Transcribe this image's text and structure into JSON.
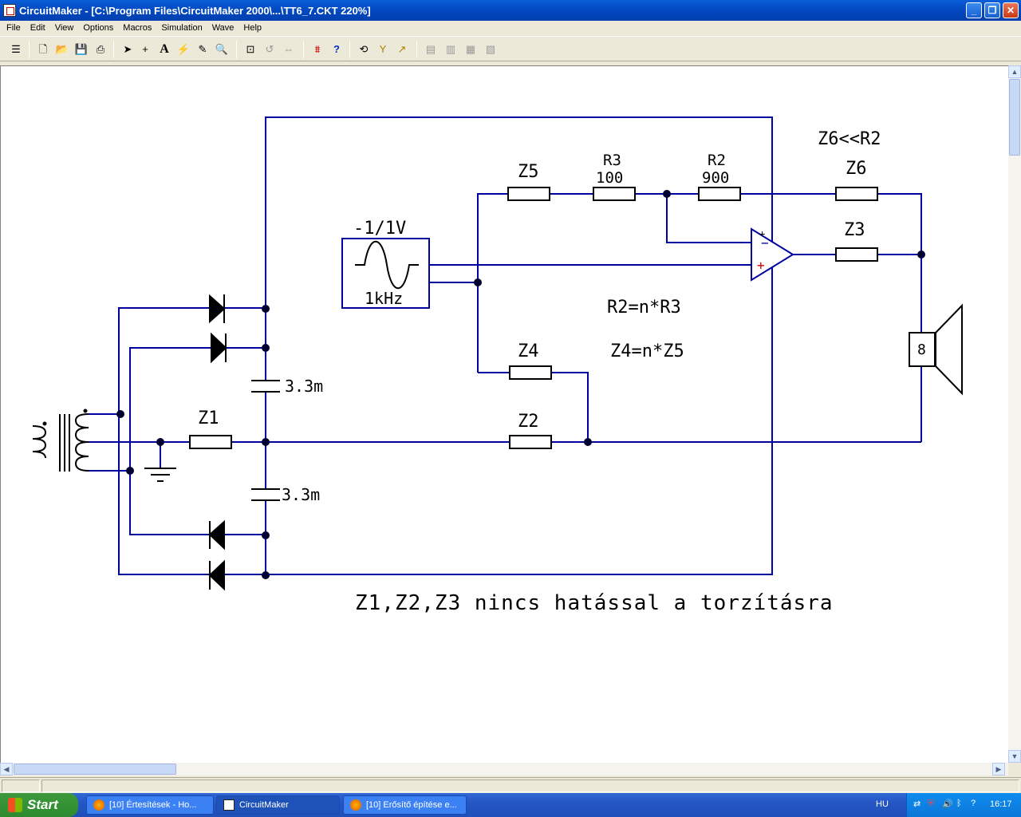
{
  "window": {
    "title": "CircuitMaker - [C:\\Program Files\\CircuitMaker 2000\\...\\TT6_7.CKT 220%]"
  },
  "menu": [
    "File",
    "Edit",
    "View",
    "Options",
    "Macros",
    "Simulation",
    "Wave",
    "Help"
  ],
  "toolbar": {
    "icons": [
      "tree-icon",
      "new-file-icon",
      "open-folder-icon",
      "save-icon",
      "print-icon",
      "arrow-tool-icon",
      "wire-tool-icon",
      "text-tool-icon",
      "probe-tool-icon",
      "delete-tool-icon",
      "zoom-tool-icon",
      "zoom-fit-icon",
      "rotate-icon",
      "mirror-icon",
      "netlist-icon",
      "help-icon",
      "undo-icon",
      "digital-probe-icon",
      "analog-probe-icon",
      "align-icon",
      "align2-icon",
      "align3-icon",
      "align4-icon"
    ]
  },
  "schematic": {
    "source_label": "-1/1V",
    "source_freq": "1kHz",
    "z5": "Z5",
    "r3": "R3",
    "r3_val": "100",
    "r2": "R2",
    "r2_val": "900",
    "z6_note": "Z6<<R2",
    "z6": "Z6",
    "z3": "Z3",
    "z4": "Z4",
    "z2": "Z2",
    "z1": "Z1",
    "cap_top": "3.3m",
    "cap_bottom": "3.3m",
    "eq1": "R2=n*R3",
    "eq2": "Z4=n*Z5",
    "speaker": "8",
    "note": "Z1,Z2,Z3 nincs hatással a torzításra",
    "opamp_minus": "−",
    "opamp_plus": "+",
    "wire_color": "#0000a0"
  },
  "taskbar": {
    "start": "Start",
    "tasks": [
      "[10] Értesítések - Ho...",
      "CircuitMaker",
      "[10] Erősítő építése e..."
    ],
    "lang": "HU",
    "clock": "16:17"
  }
}
